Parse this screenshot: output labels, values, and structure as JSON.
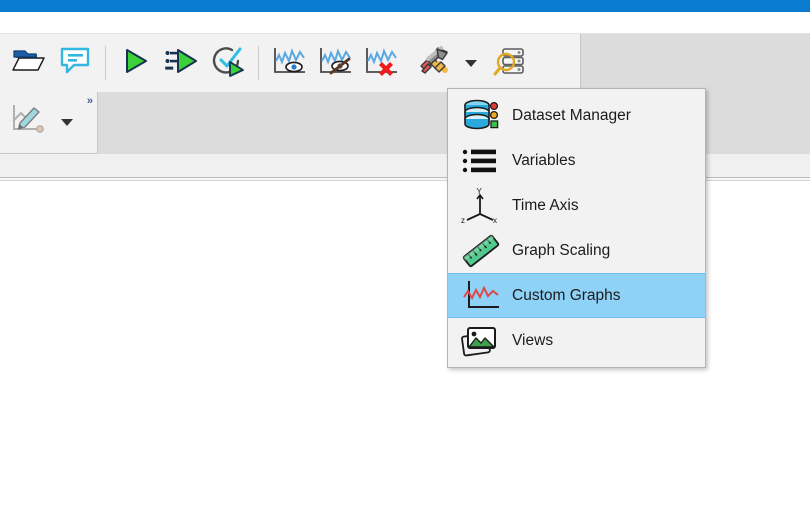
{
  "window": {
    "title_bar_color": "#0a7cd0",
    "toolbar_bg": "#f2f2f2",
    "panel_bg": "#dcdcdc",
    "workspace_bg": "#ffffff"
  },
  "toolbar": {
    "groups": [
      {
        "name": "file-group",
        "buttons": [
          {
            "icon": "open-folder-icon",
            "label": "Open"
          },
          {
            "icon": "comment-icon",
            "label": "Comment"
          }
        ]
      },
      {
        "name": "run-group",
        "buttons": [
          {
            "icon": "play-icon",
            "label": "Start Simulation"
          },
          {
            "icon": "step-play-icon",
            "label": "Step Simulation"
          },
          {
            "icon": "check-play-icon",
            "label": "Check and Simulate"
          }
        ]
      },
      {
        "name": "graph-group",
        "buttons": [
          {
            "icon": "graph-show-icon",
            "label": "Show Graph"
          },
          {
            "icon": "graph-hide-icon",
            "label": "Hide Graph"
          },
          {
            "icon": "graph-delete-icon",
            "label": "Delete Graph"
          }
        ]
      },
      {
        "name": "tools-group",
        "buttons": [
          {
            "icon": "tools-hammer-icon",
            "label": "Tools"
          },
          {
            "icon": "chevron-down-icon",
            "label": "Tools Options"
          },
          {
            "icon": "inspect-database-icon",
            "label": "Inspect"
          }
        ]
      }
    ],
    "row2": {
      "buttons": [
        {
          "icon": "edit-graph-icon",
          "label": "Edit Graph"
        },
        {
          "icon": "chevron-down-icon",
          "label": "Edit Graph Options"
        }
      ],
      "overflow_label": "»"
    }
  },
  "menu": {
    "name": "tools-dropdown-menu",
    "selected_index": 4,
    "highlight_color": "#8fd2f7",
    "items": [
      {
        "label": "Dataset Manager",
        "icon": "database-icon"
      },
      {
        "label": "Variables",
        "icon": "list-icon"
      },
      {
        "label": "Time Axis",
        "icon": "axes-icon"
      },
      {
        "label": "Graph Scaling",
        "icon": "ruler-icon"
      },
      {
        "label": "Custom Graphs",
        "icon": "custom-graph-icon"
      },
      {
        "label": "Views",
        "icon": "images-icon"
      }
    ]
  }
}
